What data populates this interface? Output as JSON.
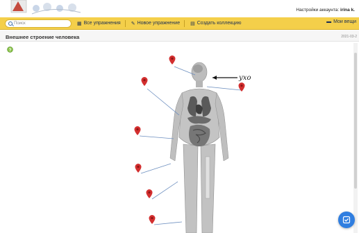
{
  "header": {
    "account_label": "Настройки аккаунта:",
    "account_user": "irina k."
  },
  "toolbar": {
    "search_placeholder": "Поиск",
    "all_exercises": "Все упражнения",
    "new_exercise": "Новое упражнение",
    "create_collection": "Создать коллекцию",
    "my_things": "Мои вещи"
  },
  "page": {
    "title": "Внешнее строение человека",
    "date": "2021-03-2"
  },
  "exercise": {
    "answered_label": "ухо",
    "pins": 7
  },
  "colors": {
    "toolbar": "#f4cf4a",
    "pin": "#d32f2f",
    "link_line": "#6c8ebf",
    "fab": "#2f7ee0"
  }
}
